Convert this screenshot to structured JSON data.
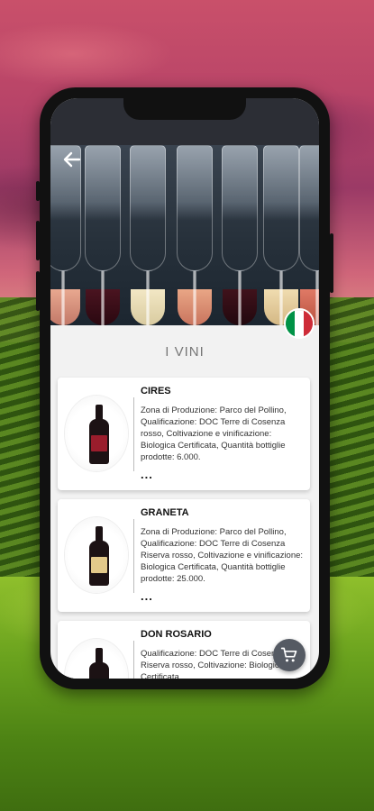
{
  "page": {
    "section_title": "I VINI"
  },
  "icons": {
    "back": "back-arrow-icon",
    "flag": "italy-flag-icon",
    "cart": "shopping-cart-icon"
  },
  "colors": {
    "flag_green": "#009246",
    "flag_white": "#ffffff",
    "flag_red": "#ce2b37",
    "fab": "#555a63"
  },
  "wines": [
    {
      "name": "CIRES",
      "description": "Zona di Produzione: Parco del Pollino, Qualificazione: DOC Terre di Cosenza rosso, Coltivazione e vinificazione: Biologica Certificata, Quantità bottiglie prodotte: 6.000.",
      "more": "...",
      "label_color": "#9a1d2c"
    },
    {
      "name": "GRANETA",
      "description": "Zona di Produzione: Parco del Pollino, Qualificazione: DOC Terre di Cosenza Riserva rosso, Coltivazione e vinificazione: Biologica Certificata, Quantità bottiglie prodotte: 25.000.",
      "more": "...",
      "label_color": "#e3c98a"
    },
    {
      "name": "DON ROSARIO",
      "description": "Qualificazione: DOC Terre di Cosenza Riserva rosso, Coltivazione: Biologica Certificata",
      "more": "...",
      "label_color": "#d9c08a"
    }
  ]
}
